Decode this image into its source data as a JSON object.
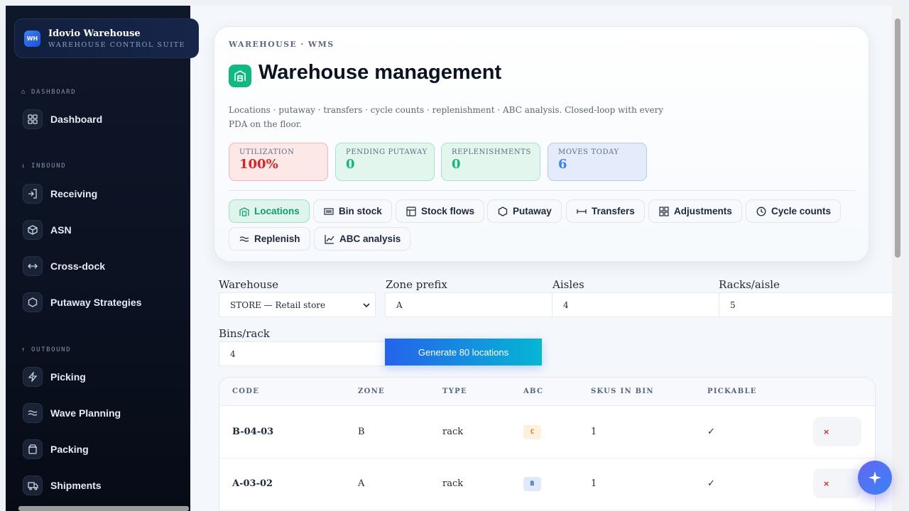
{
  "brand": {
    "logo": "WH",
    "title": "Idovio Warehouse",
    "subtitle": "WAREHOUSE CONTROL SUITE"
  },
  "sidebar": {
    "sections": [
      {
        "label": "⌂ DASHBOARD",
        "items": [
          {
            "label": "Dashboard",
            "icon": "grid-icon"
          }
        ]
      },
      {
        "label": "↓ INBOUND",
        "items": [
          {
            "label": "Receiving",
            "icon": "login-icon"
          },
          {
            "label": "ASN",
            "icon": "box-icon"
          },
          {
            "label": "Cross-dock",
            "icon": "cross-dock-icon"
          },
          {
            "label": "Putaway Strategies",
            "icon": "hexagon-icon"
          }
        ]
      },
      {
        "label": "↑ OUTBOUND",
        "items": [
          {
            "label": "Picking",
            "icon": "bolt-icon"
          },
          {
            "label": "Wave Planning",
            "icon": "waves-icon"
          },
          {
            "label": "Packing",
            "icon": "package-icon"
          },
          {
            "label": "Shipments",
            "icon": "truck-icon"
          }
        ]
      }
    ]
  },
  "hero": {
    "eyebrow": "WAREHOUSE · WMS",
    "title": "Warehouse management",
    "description": "Locations · putaway · transfers · cycle counts · replenishment · ABC analysis. Closed-loop with every PDA on the floor."
  },
  "stats": [
    {
      "label": "UTILIZATION",
      "value": "100%",
      "bg": "#fde8e8",
      "border": "#f5b5b5",
      "color": "#dc2626"
    },
    {
      "label": "PENDING PUTAWAY",
      "value": "0",
      "bg": "#e2f6ee",
      "border": "#a7e3cb",
      "color": "#10b981"
    },
    {
      "label": "REPLENISHMENTS",
      "value": "0",
      "bg": "#e2f6ee",
      "border": "#a7e3cb",
      "color": "#10b981"
    },
    {
      "label": "MOVES TODAY",
      "value": "6",
      "bg": "#e4ecfb",
      "border": "#b5c9f1",
      "color": "#3b82f6"
    }
  ],
  "tabs": [
    {
      "label": "Locations",
      "icon": "warehouse-icon",
      "active": true
    },
    {
      "label": "Bin stock",
      "icon": "barcode-icon"
    },
    {
      "label": "Stock flows",
      "icon": "table-icon"
    },
    {
      "label": "Putaway",
      "icon": "hexagon-icon"
    },
    {
      "label": "Transfers",
      "icon": "transfer-icon"
    },
    {
      "label": "Adjustments",
      "icon": "grid-icon"
    },
    {
      "label": "Cycle counts",
      "icon": "clock-icon"
    },
    {
      "label": "Replenish",
      "icon": "waves-icon"
    },
    {
      "label": "ABC analysis",
      "icon": "chart-icon"
    }
  ],
  "form": {
    "warehouse_label": "Warehouse",
    "warehouse_value": "STORE — Retail store",
    "zone_label": "Zone prefix",
    "zone_value": "A",
    "aisles_label": "Aisles",
    "aisles_value": "4",
    "racks_label": "Racks/aisle",
    "racks_value": "5",
    "bins_label": "Bins/rack",
    "bins_value": "4",
    "generate_label": "Generate 80 locations"
  },
  "table": {
    "headers": [
      "CODE",
      "ZONE",
      "TYPE",
      "ABC",
      "SKUS IN BIN",
      "PICKABLE"
    ],
    "rows": [
      {
        "code": "B-04-03",
        "zone": "B",
        "type": "rack",
        "abc": "C",
        "skus": "1",
        "pickable": "✓",
        "delete": "×"
      },
      {
        "code": "A-03-02",
        "zone": "A",
        "type": "rack",
        "abc": "B",
        "skus": "1",
        "pickable": "✓",
        "delete": "×"
      }
    ]
  },
  "colors": {
    "abc_C_bg": "#fdf0dc",
    "abc_C_fg": "#d97706",
    "abc_B_bg": "#e0e9fb",
    "abc_B_fg": "#1d4ed8"
  },
  "fab_icon": "sparkle-icon"
}
